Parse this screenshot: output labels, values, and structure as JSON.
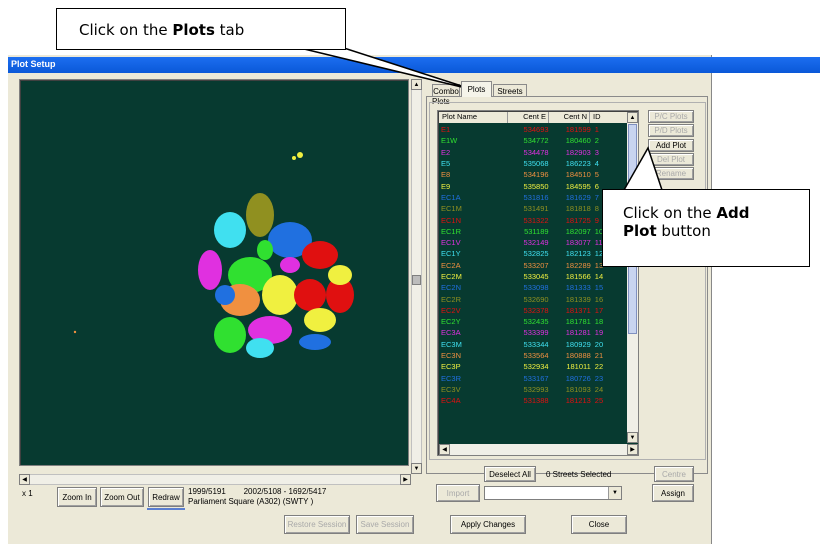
{
  "window": {
    "title": "Plot Setup"
  },
  "callouts": {
    "plots_tab": {
      "prefix": "Click on the ",
      "bold": "Plots",
      "suffix": " tab"
    },
    "add_plot": {
      "prefix": "Click on the ",
      "bold1": "Add",
      "bold2": "Plot",
      "suffix": " button"
    }
  },
  "tabs": [
    {
      "label": "Combo"
    },
    {
      "label": "Plots"
    },
    {
      "label": "Streets"
    }
  ],
  "plots_group": {
    "label": "Plots"
  },
  "table": {
    "headers": [
      "Plot Name",
      "Cent E",
      "Cent N",
      "ID"
    ],
    "rows": [
      {
        "name": "E1",
        "e": "534693",
        "n": "181599",
        "id": "1",
        "color": "#e01010"
      },
      {
        "name": "E1W",
        "e": "534772",
        "n": "180460",
        "id": "2",
        "color": "#30e030"
      },
      {
        "name": "E2",
        "e": "534478",
        "n": "182903",
        "id": "3",
        "color": "#e030e0"
      },
      {
        "name": "E5",
        "e": "535068",
        "n": "186223",
        "id": "4",
        "color": "#40e0f0"
      },
      {
        "name": "E8",
        "e": "534196",
        "n": "184510",
        "id": "5",
        "color": "#f09040"
      },
      {
        "name": "E9",
        "e": "535850",
        "n": "184595",
        "id": "6",
        "color": "#f0f040"
      },
      {
        "name": "EC1A",
        "e": "531816",
        "n": "181629",
        "id": "7",
        "color": "#2070e0"
      },
      {
        "name": "EC1M",
        "e": "531491",
        "n": "181818",
        "id": "8",
        "color": "#909020"
      },
      {
        "name": "EC1N",
        "e": "531322",
        "n": "181725",
        "id": "9",
        "color": "#e01010"
      },
      {
        "name": "EC1R",
        "e": "531189",
        "n": "182097",
        "id": "10",
        "color": "#30e030"
      },
      {
        "name": "EC1V",
        "e": "532149",
        "n": "183077",
        "id": "11",
        "color": "#e030e0"
      },
      {
        "name": "EC1Y",
        "e": "532825",
        "n": "182123",
        "id": "12",
        "color": "#40e0f0"
      },
      {
        "name": "EC2A",
        "e": "533207",
        "n": "182289",
        "id": "13",
        "color": "#f09040"
      },
      {
        "name": "EC2M",
        "e": "533045",
        "n": "181566",
        "id": "14",
        "color": "#f0f040"
      },
      {
        "name": "EC2N",
        "e": "533098",
        "n": "181333",
        "id": "15",
        "color": "#2070e0"
      },
      {
        "name": "EC2R",
        "e": "532690",
        "n": "181339",
        "id": "16",
        "color": "#909020"
      },
      {
        "name": "EC2V",
        "e": "532378",
        "n": "181371",
        "id": "17",
        "color": "#e01010"
      },
      {
        "name": "EC2Y",
        "e": "532435",
        "n": "181781",
        "id": "18",
        "color": "#30e030"
      },
      {
        "name": "EC3A",
        "e": "533399",
        "n": "181281",
        "id": "19",
        "color": "#e030e0"
      },
      {
        "name": "EC3M",
        "e": "533344",
        "n": "180929",
        "id": "20",
        "color": "#40e0f0"
      },
      {
        "name": "EC3N",
        "e": "533564",
        "n": "180888",
        "id": "21",
        "color": "#f09040"
      },
      {
        "name": "EC3P",
        "e": "532934",
        "n": "181011",
        "id": "22",
        "color": "#f0f040"
      },
      {
        "name": "EC3R",
        "e": "533167",
        "n": "180726",
        "id": "23",
        "color": "#2070e0"
      },
      {
        "name": "EC3V",
        "e": "532993",
        "n": "181093",
        "id": "24",
        "color": "#909020"
      },
      {
        "name": "EC4A",
        "e": "531388",
        "n": "181213",
        "id": "25",
        "color": "#e01010"
      }
    ]
  },
  "side_buttons": {
    "pc_plots": "P/C Plots",
    "pd_plots": "P/D Plots",
    "add_plot": "Add Plot",
    "del_plot": "Del Plot",
    "rename": "Rename"
  },
  "under_table": {
    "deselect_all": "Deselect All",
    "streets_selected": "0 Streets Selected",
    "centre": "Centre",
    "import": "Import",
    "assign": "Assign"
  },
  "map_footer": {
    "zoom_level": "x 1",
    "zoom_in": "Zoom In",
    "zoom_out": "Zoom Out",
    "redraw": "Redraw",
    "coords_line": "1999/5191        2002/5108 - 1692/5417",
    "location": "Parliament Square (A302) (SWTY )"
  },
  "bottom_buttons": {
    "restore_session": "Restore Session",
    "save_session": "Save Session",
    "apply_changes": "Apply Changes",
    "close": "Close"
  },
  "colors": {
    "title_bar": "#0a5fe0",
    "map_bg": "#073a30",
    "table_bg": "#073a30"
  }
}
